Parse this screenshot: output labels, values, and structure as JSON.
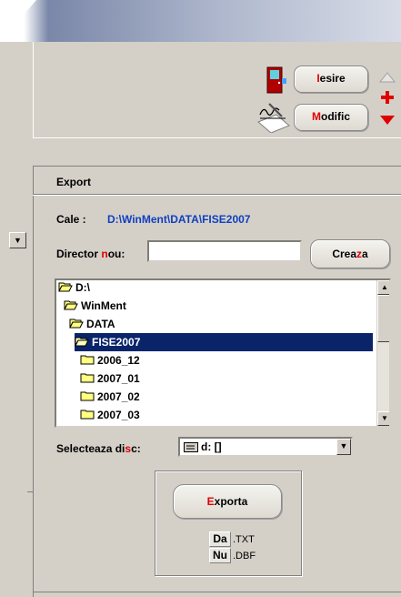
{
  "toolbar": {
    "exit_label": "Iesire",
    "exit_hotkey": "I",
    "modify_label": "Modific",
    "modify_hotkey": "M"
  },
  "section": {
    "title": "Export"
  },
  "path": {
    "label": "Cale :",
    "value": "D:\\WinMent\\DATA\\FISE2007"
  },
  "new_dir": {
    "label_before": "Director ",
    "label_hot": "n",
    "label_after": "ou:",
    "value": "",
    "create_before": "Crea",
    "create_hot": "z",
    "create_after": "a"
  },
  "tree": {
    "items": [
      {
        "label": "D:\\",
        "indent": 0,
        "open": true
      },
      {
        "label": "WinMent",
        "indent": 1,
        "open": true
      },
      {
        "label": "DATA",
        "indent": 2,
        "open": true
      },
      {
        "label": "FISE2007",
        "indent": 3,
        "open": true,
        "selected": true
      },
      {
        "label": "2006_12",
        "indent": 4,
        "open": false
      },
      {
        "label": "2007_01",
        "indent": 4,
        "open": false
      },
      {
        "label": "2007_02",
        "indent": 4,
        "open": false
      },
      {
        "label": "2007_03",
        "indent": 4,
        "open": false
      }
    ]
  },
  "disk": {
    "label_before": "Selecteaza di",
    "label_hot": "s",
    "label_after": "c:",
    "value": "d: []"
  },
  "export": {
    "button_hot": "E",
    "button_rest": "xporta",
    "options": [
      {
        "key": "Da",
        "ext": ".TXT"
      },
      {
        "key": "Nu",
        "ext": ".DBF"
      }
    ]
  },
  "colors": {
    "accent_red": "#e00000",
    "path_blue": "#1040c0",
    "selection": "#0a246a"
  }
}
